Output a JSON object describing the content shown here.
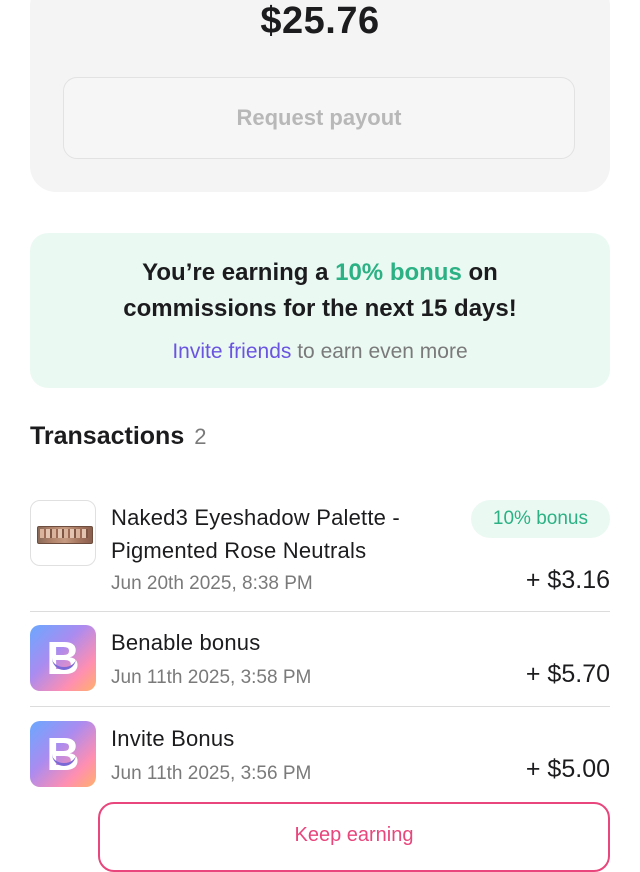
{
  "balance": {
    "amount": "$25.76",
    "payout_label": "Request payout"
  },
  "bonus": {
    "line1_prefix": "You’re earning a ",
    "highlight": "10% bonus",
    "line1_suffix": " on",
    "line2": "commissions for the next 15 days!",
    "invite_link": "Invite friends",
    "invite_suffix": " to earn even more",
    "accent_color": "#2bb184",
    "link_color": "#6a55e0"
  },
  "transactions": {
    "title": "Transactions",
    "count": "2",
    "items": [
      {
        "title_line1": "Naked3 Eyeshadow Palette -",
        "title_line2": "Pigmented Rose Neutrals",
        "date": "Jun 20th 2025, 8:38 PM",
        "amount": "+ $3.16",
        "badge": "10% bonus",
        "icon": "eyeshadow-palette-thumbnail"
      },
      {
        "title_line1": "Benable bonus",
        "date": "Jun 11th 2025, 3:58 PM",
        "amount": "+ $5.70",
        "icon": "benable-logo-icon"
      },
      {
        "title_line1": "Invite Bonus",
        "date": "Jun 11th 2025, 3:56 PM",
        "amount": "+ $5.00",
        "icon": "benable-logo-icon"
      }
    ]
  },
  "cta": {
    "keep_earning_label": "Keep earning",
    "color": "#e8467c"
  }
}
